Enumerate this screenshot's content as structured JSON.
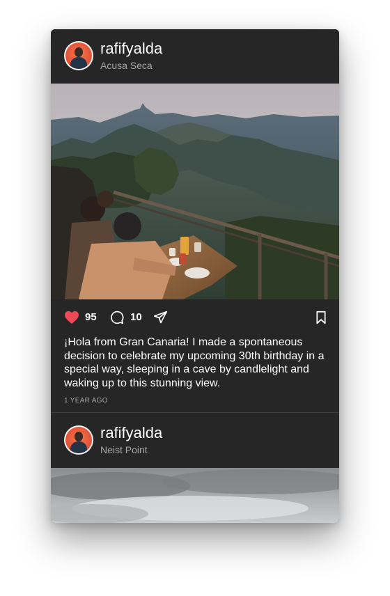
{
  "posts": [
    {
      "username": "rafifyalda",
      "location": "Acusa Seca",
      "likes": "95",
      "comments": "10",
      "liked": true,
      "caption": "¡Hola from Gran Canaria! I made a spontaneous decision to celebrate my upcoming 30th birthday in a special way, sleeping in a cave by candlelight and waking up to this stunning view.",
      "timestamp": "1 YEAR AGO"
    },
    {
      "username": "rafifyalda",
      "location": "Neist Point"
    }
  ],
  "colors": {
    "background": "#262626",
    "like_red": "#ed4956",
    "text_primary": "#ffffff",
    "text_secondary": "#a7a7a7"
  },
  "icons": {
    "like": "heart-icon",
    "comment": "comment-bubble-icon",
    "share": "paper-plane-icon",
    "save": "bookmark-icon"
  }
}
